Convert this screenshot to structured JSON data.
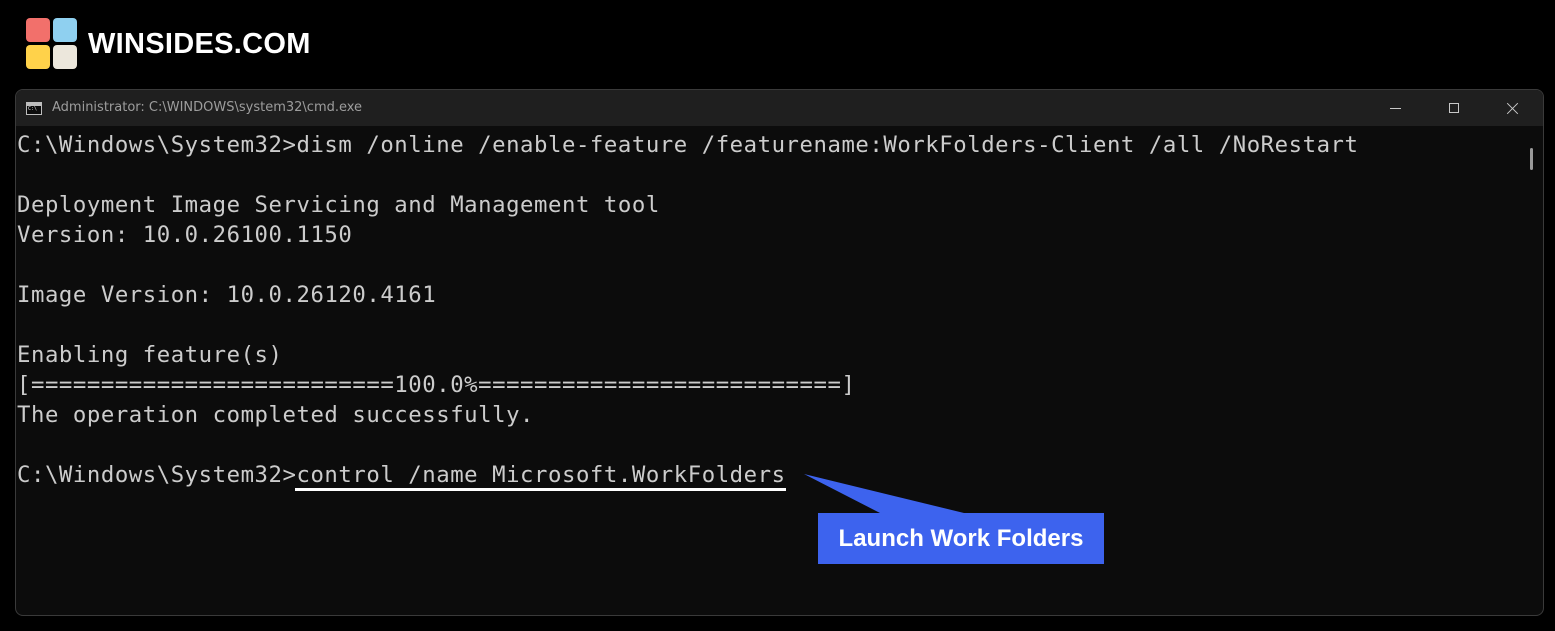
{
  "brand": {
    "name": "WINSIDES.COM",
    "logo_colors": [
      "#f2706b",
      "#8fd0f0",
      "#ffd24a",
      "#ece7dc"
    ]
  },
  "window": {
    "title": "Administrator: C:\\WINDOWS\\system32\\cmd.exe",
    "icon": "cmd-icon",
    "buttons": [
      "minimize-icon",
      "maximize-icon",
      "close-icon"
    ]
  },
  "console": {
    "lines": [
      "C:\\Windows\\System32>dism /online /enable-feature /featurename:WorkFolders-Client /all /NoRestart",
      "",
      "Deployment Image Servicing and Management tool",
      "Version: 10.0.26100.1150",
      "",
      "Image Version: 10.0.26120.4161",
      "",
      "Enabling feature(s)",
      "[==========================100.0%==========================]",
      "The operation completed successfully.",
      "",
      "C:\\Windows\\System32>control /name Microsoft.WorkFolders"
    ]
  },
  "annotation": {
    "label": "Launch Work Folders",
    "color": "#3d63ee"
  }
}
